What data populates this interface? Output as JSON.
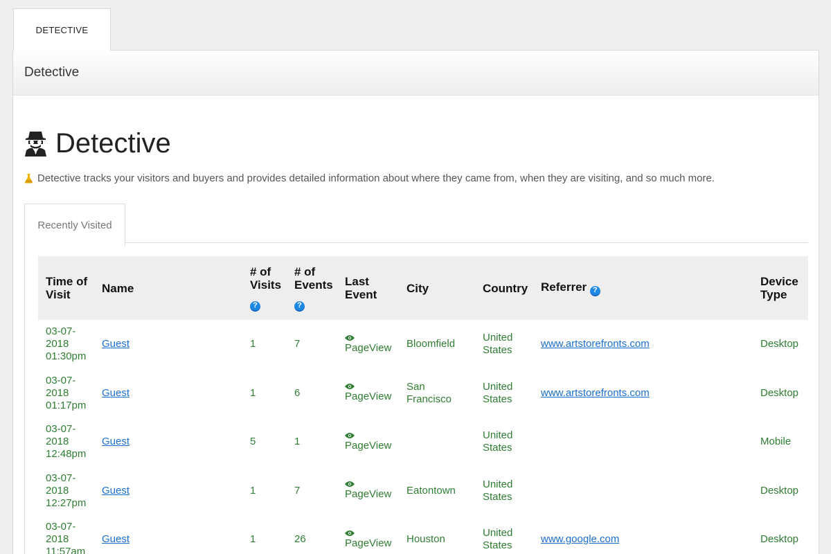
{
  "top_tab": {
    "label": "DETECTIVE"
  },
  "panel": {
    "header": "Detective"
  },
  "page": {
    "title": "Detective",
    "description": "Detective tracks your visitors and buyers and provides detailed information about where they came from, when they are visiting, and so much more."
  },
  "subtab": {
    "label": "Recently Visited"
  },
  "table": {
    "headers": {
      "time": "Time of Visit",
      "name": "Name",
      "visits": "# of Visits",
      "events": "# of Events",
      "last_event": "Last Event",
      "city": "City",
      "country": "Country",
      "referrer": "Referrer",
      "device": "Device Type"
    },
    "rows": [
      {
        "date": "03-07-2018",
        "time": "01:30pm",
        "name": "Guest",
        "visits": "1",
        "events": "7",
        "last_event": "PageView",
        "city": "Bloomfield",
        "country": "United States",
        "referrer": "www.artstorefronts.com",
        "device": "Desktop"
      },
      {
        "date": "03-07-2018",
        "time": "01:17pm",
        "name": "Guest",
        "visits": "1",
        "events": "6",
        "last_event": "PageView",
        "city": "San Francisco",
        "country": "United States",
        "referrer": "www.artstorefronts.com",
        "device": "Desktop"
      },
      {
        "date": "03-07-2018",
        "time": "12:48pm",
        "name": "Guest",
        "visits": "5",
        "events": "1",
        "last_event": "PageView",
        "city": "",
        "country": "United States",
        "referrer": "",
        "device": "Mobile"
      },
      {
        "date": "03-07-2018",
        "time": "12:27pm",
        "name": "Guest",
        "visits": "1",
        "events": "7",
        "last_event": "PageView",
        "city": "Eatontown",
        "country": "United States",
        "referrer": "",
        "device": "Desktop"
      },
      {
        "date": "03-07-2018",
        "time": "11:57am",
        "name": "Guest",
        "visits": "1",
        "events": "26",
        "last_event": "PageView",
        "city": "Houston",
        "country": "United States",
        "referrer": "www.google.com",
        "device": "Desktop"
      }
    ]
  },
  "colors": {
    "accent_green": "#2e7d32",
    "link_blue": "#1a6fd1",
    "help_blue": "#1e88e5"
  },
  "icons": {
    "title": "detective-icon",
    "description": "flask-icon",
    "help": "help-icon",
    "event": "eye-icon"
  }
}
